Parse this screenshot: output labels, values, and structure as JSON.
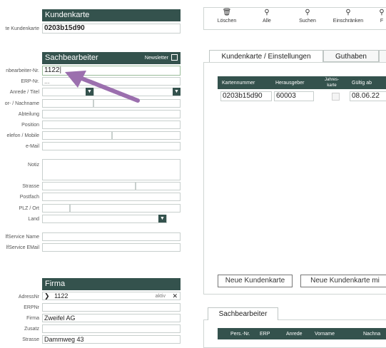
{
  "kundenkarte": {
    "header": "Kundenkarte",
    "label": "te Kundenkarte",
    "value": "0203b15d90"
  },
  "sachbearbeiter": {
    "header": "Sachbearbeiter",
    "newsletter_label": "Newsletter",
    "labels": {
      "nr": "nbearbeiter-Nr.",
      "erp": "ERP-Nr.",
      "anrede": "Anrede / Titel",
      "name": "or- / Nachname",
      "abteilung": "Abteilung",
      "position": "Position",
      "telefon": "elefon / Mobile",
      "email": "e-Mail",
      "notiz": "Notiz",
      "strasse": "Strasse",
      "postfach": "Postfach",
      "plz": "PLZ / Ort",
      "land": "Land",
      "selfservice_name": "lfService Name",
      "selfservice_email": "lfService EMail"
    },
    "values": {
      "nr": "1122",
      "erp": "..."
    }
  },
  "firma": {
    "header": "Firma",
    "labels": {
      "adressnr": "AdressNr",
      "erpnr": "ERPNr",
      "firma": "Firma",
      "zusatz": "Zusatz",
      "strasse": "Strasse"
    },
    "values": {
      "adressnr": "1122",
      "status": "aktiv",
      "firma": "Zweifel AG",
      "strasse": "Dammweg 43"
    }
  },
  "toolbar": {
    "items": [
      {
        "label": "Löschen",
        "icon": "trash-icon"
      },
      {
        "label": "Alle",
        "icon": "search-icon"
      },
      {
        "label": "Suchen",
        "icon": "search-icon"
      },
      {
        "label": "Einschränken",
        "icon": "search-icon"
      },
      {
        "label": "F",
        "icon": "search-icon"
      }
    ]
  },
  "tabs": [
    "Kundenkarte / Einstellungen",
    "Guthaben"
  ],
  "card_table": {
    "headers": [
      "Kartennummer",
      "Herausgeber",
      "Jahres-\nkarte",
      "Gültig ab"
    ],
    "row": {
      "kartennummer": "0203b15d90",
      "herausgeber": "60003",
      "gueltig_ab": "08.06.22"
    }
  },
  "buttons": {
    "neue_kundenkarte": "Neue Kundenkarte",
    "neue_kundenkarte_mit": "Neue Kundenkarte mi"
  },
  "lower_tab": "Sachbearbeiter",
  "lower_table_headers": [
    "Pers.-Nr.",
    "ERP",
    "Anrede",
    "Vorname",
    "Nachna"
  ],
  "colors": {
    "accent": "#34524d",
    "arrow": "#9b6fae"
  }
}
